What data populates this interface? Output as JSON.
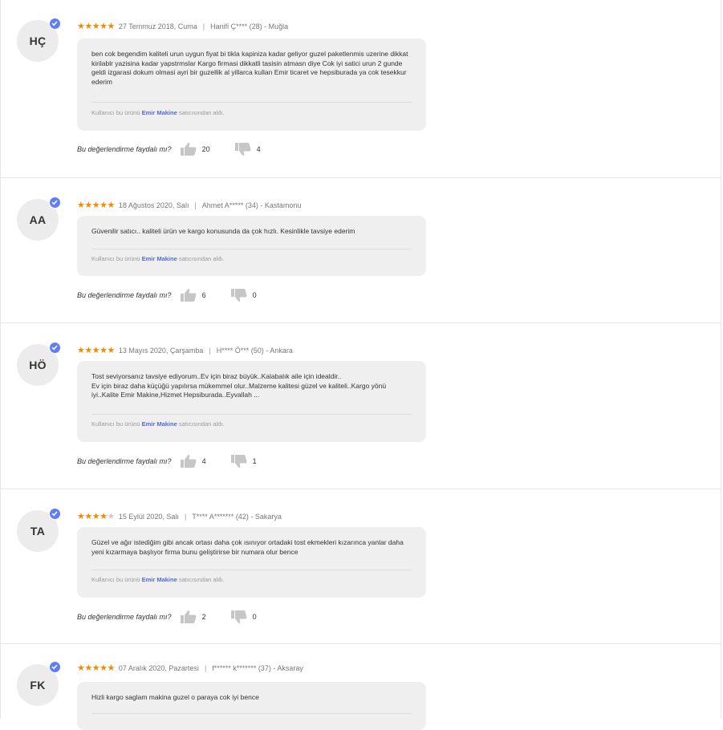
{
  "seller_prefix": "Kullanıcı bu ürünü",
  "seller_suffix": "satıcısından aldı.",
  "helpful_question": "Bu değerlendirme faydalı mı?",
  "reviews": [
    {
      "initials": "HÇ",
      "rating": 5,
      "date": "27 Temmuz 2018, Cuma",
      "author": "Hanifi Ç**** (28) - Muğla",
      "text": "ben cok begendim kaliteli urun uygun fiyat bi tikla kapiniza kadar geliyor guzel paketlenmis uzerine dikkat\nkirilablr yazisina kadar yapstrmslar Kargo firmasi dikkatli tasisin atmasn diye Cok iyi satici urun 2 gunde\ngeldi izgarasi dokum olmasi ayri bir guzellik  al yillarca kullan Emir ticaret ve hepsiburada ya cok tesekkur\nederim",
      "seller": "Emir Makine",
      "likes": "20",
      "dislikes": "4"
    },
    {
      "initials": "AA",
      "rating": 5,
      "date": "18 Ağustos 2020, Salı",
      "author": "Ahmet A***** (34) - Kastamonu",
      "text": "Güvenilir satıcı.. kaliteli ürün ve kargo konusunda da çok hızlı. Kesinlikle tavsiye ederim",
      "seller": "Emir Makine",
      "likes": "6",
      "dislikes": "0"
    },
    {
      "initials": "HÖ",
      "rating": 5,
      "date": "13 Mayıs 2020, Çarşamba",
      "author": "H**** Ö*** (50) - Ankara",
      "text": "Tost seviyorsanız tavsiye ediyorum..Ev için biraz büyük..Kalabalık aile için idealdir..\nEv için biraz daha küçüğü yapılırsa mükemmel olur..Malzeme kalitesi güzel ve kaliteli..Kargo yönü\niyi..Kalite Emir Makine,Hizmet Hepsiburada..Eyvallah ...",
      "seller": "Emir Makine",
      "likes": "4",
      "dislikes": "1"
    },
    {
      "initials": "TA",
      "rating": 4,
      "date": "15 Eylül 2020, Salı",
      "author": "T**** A******* (42) - Sakarya",
      "text": "Güzel ve ağır istediğim gibi ancak ortası daha çok ısınıyor ortadaki tost ekmekleri kızarınca yanlar daha\nyeni kızarmaya başlıyor firma bunu geliştirirse bir numara olur bence",
      "seller": "Emir Makine",
      "likes": "2",
      "dislikes": "0"
    },
    {
      "initials": "FK",
      "rating": 5,
      "date": "07 Aralık 2020, Pazartesi",
      "author": "f****** k******* (37) - Aksaray",
      "text": "Hizli kargo saglam makina guzel o paraya cok iyi bence",
      "seller": "",
      "likes": "",
      "dislikes": ""
    }
  ]
}
